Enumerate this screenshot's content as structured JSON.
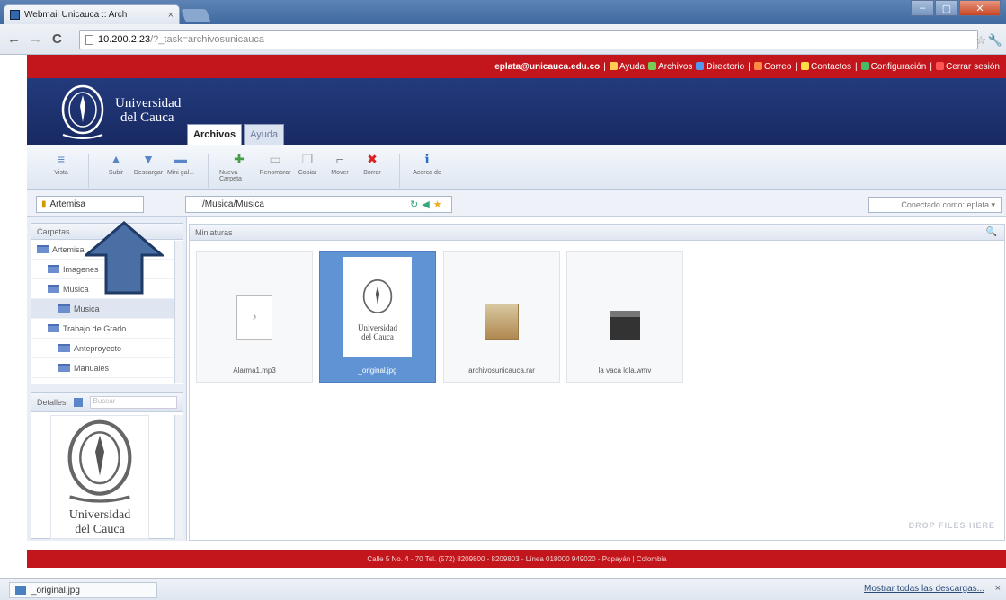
{
  "browser": {
    "tab_title": "Webmail Unicauca :: Arch",
    "tab_close": "×",
    "url_domain": "10.200.2.23",
    "url_path": "/?_task=archivosunicauca",
    "window_buttons": {
      "minimize": "–",
      "maximize": "▢",
      "close": "✕"
    }
  },
  "topbar": {
    "user_email": "eplata@unicauca.edu.co",
    "links": [
      "Ayuda",
      "Archivos",
      "Directorio",
      "Correo",
      "Contactos",
      "Configuración",
      "Cerrar sesión"
    ],
    "link_colors": [
      "#ffcc55",
      "#77cc55",
      "#5599ee",
      "#ff8844",
      "#ffdd44",
      "#44bb66",
      "#ff5555"
    ]
  },
  "brand": {
    "line1": "Universidad",
    "line2": "del Cauca"
  },
  "app_tabs": [
    {
      "label": "Archivos"
    },
    {
      "label": "Ayuda"
    }
  ],
  "toolbar": {
    "buttons": [
      {
        "label": "Vista",
        "icon": "≡"
      },
      {
        "label": "Subir",
        "icon": "▲"
      },
      {
        "label": "Descargar",
        "icon": "▼"
      },
      {
        "label": "Mini gal...",
        "icon": "▬"
      },
      {
        "label": "Nueva Carpeta",
        "icon": "✚"
      },
      {
        "label": "Renombrar",
        "icon": "▭"
      },
      {
        "label": "Copiar",
        "icon": "❐"
      },
      {
        "label": "Mover",
        "icon": "⌐"
      },
      {
        "label": "Borrar",
        "icon": "✖"
      },
      {
        "label": "Acerca de",
        "icon": "ℹ"
      }
    ]
  },
  "pathbar": {
    "folder_selected": "Artemisa",
    "path_value": "/Musica/Musica",
    "connected_as": "Conectado como: eplata ▾"
  },
  "folders": {
    "header": "Carpetas",
    "items": [
      {
        "label": "Artemisa",
        "indent": 0
      },
      {
        "label": "Imagenes",
        "indent": 1
      },
      {
        "label": "Musica",
        "indent": 1
      },
      {
        "label": "Musica",
        "indent": 2,
        "selected": true
      },
      {
        "label": "Trabajo de Grado",
        "indent": 1
      },
      {
        "label": "Anteproyecto",
        "indent": 2
      },
      {
        "label": "Manuales",
        "indent": 2
      }
    ]
  },
  "details": {
    "header": "Detalles",
    "search_placeholder": "Buscar"
  },
  "main": {
    "header": "Miniaturas",
    "files": [
      {
        "name": "Alarma1.mp3",
        "type": "audio"
      },
      {
        "name": "_original.jpg",
        "type": "image",
        "selected": true
      },
      {
        "name": "archivosunicauca.rar",
        "type": "archive"
      },
      {
        "name": "la vaca lola.wmv",
        "type": "video"
      }
    ],
    "drop_hint": "DROP FILES HERE"
  },
  "footer": {
    "text": "Calle 5 No. 4 - 70 Tel. (572) 8209800 - 8209803 - Línea 018000 949020 - Popayán | Colombia"
  },
  "downloads": {
    "item": "_original.jpg",
    "show_all": "Mostrar todas las descargas...",
    "close": "×"
  },
  "annotation": {
    "color": "#4a6fa5",
    "stroke": "#1f3a64"
  }
}
